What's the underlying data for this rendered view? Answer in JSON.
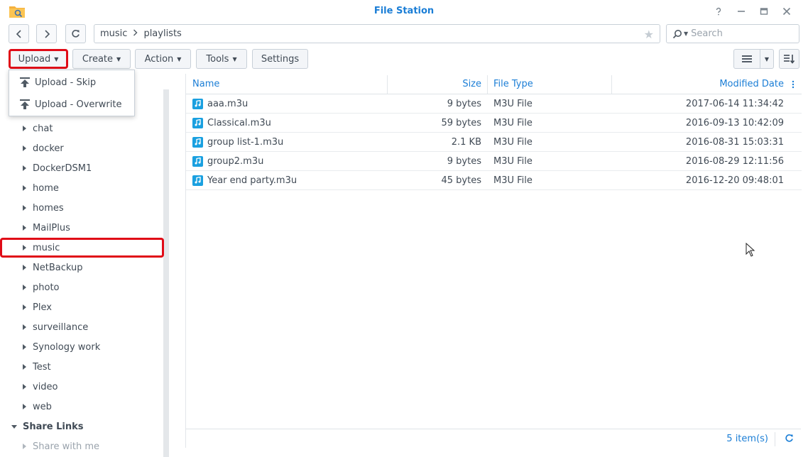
{
  "window": {
    "title": "File Station",
    "controls": [
      "help-icon",
      "minimize-icon",
      "restore-icon",
      "close-icon"
    ]
  },
  "nav": {
    "path": [
      "music",
      "playlists"
    ],
    "search_placeholder": "Search"
  },
  "toolbar": {
    "upload": "Upload",
    "create": "Create",
    "action": "Action",
    "tools": "Tools",
    "settings": "Settings"
  },
  "upload_menu": {
    "items": [
      {
        "label": "Upload - Skip",
        "icon": "upload-icon"
      },
      {
        "label": "Upload - Overwrite",
        "icon": "upload-icon"
      }
    ]
  },
  "sidebar": {
    "folders": [
      "chat",
      "docker",
      "DockerDSM1",
      "home",
      "homes",
      "MailPlus",
      "music",
      "NetBackup",
      "photo",
      "Plex",
      "surveillance",
      "Synology work",
      "Test",
      "video",
      "web"
    ],
    "share_links_label": "Share Links",
    "share_with_me": "Share with me"
  },
  "file_list": {
    "columns": {
      "name": "Name",
      "size": "Size",
      "type": "File Type",
      "modified": "Modified Date"
    },
    "rows": [
      {
        "name": "aaa.m3u",
        "size": "9 bytes",
        "type": "M3U File",
        "modified": "2017-06-14 11:34:42"
      },
      {
        "name": "Classical.m3u",
        "size": "59 bytes",
        "type": "M3U File",
        "modified": "2016-09-13 10:42:09"
      },
      {
        "name": "group list-1.m3u",
        "size": "2.1 KB",
        "type": "M3U File",
        "modified": "2016-08-31 15:03:31"
      },
      {
        "name": "group2.m3u",
        "size": "9 bytes",
        "type": "M3U File",
        "modified": "2016-08-29 12:11:56"
      },
      {
        "name": "Year end party.m3u",
        "size": "45 bytes",
        "type": "M3U File",
        "modified": "2016-12-20 09:48:01"
      }
    ],
    "item_count": "5 item(s)"
  },
  "colors": {
    "accent": "#1b7ed6",
    "highlight": "#e00b17",
    "file_icon": "#1aa0e0"
  }
}
